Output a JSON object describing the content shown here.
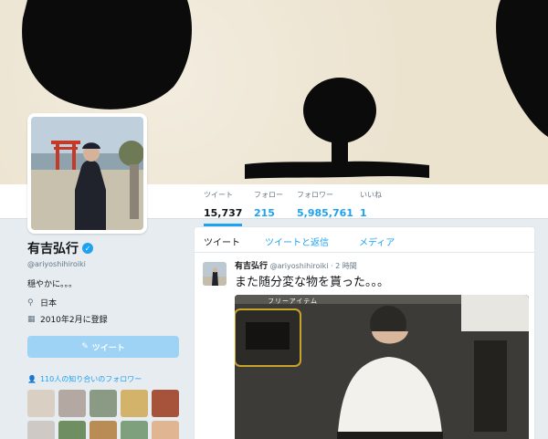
{
  "stats": [
    {
      "label": "ツイート",
      "value": "15,737"
    },
    {
      "label": "フォロー",
      "value": "215"
    },
    {
      "label": "フォロワー",
      "value": "5,985,761"
    },
    {
      "label": "いいね",
      "value": "1"
    }
  ],
  "profile": {
    "name": "有吉弘行",
    "handle": "@ariyoshihiroiki",
    "bio": "穏やかに。。。",
    "location": "日本",
    "joined": "2010年2月に登録",
    "tweet_button": "ツイート",
    "followers_you_know": "110人の知り合いのフォロワー"
  },
  "timeline": {
    "tabs": [
      "ツイート",
      "ツイートと返信",
      "メディア"
    ]
  },
  "tweet": {
    "author": "有吉弘行",
    "handle": "@ariyoshihiroiki",
    "time": "2 時間",
    "text": "また随分変な物を貰った。。。",
    "media_caption": "フリーアイテム"
  },
  "colors": {
    "accent": "#1da1f2",
    "banner": "#ece3cf",
    "background": "#e6ecf0"
  },
  "icons": [
    "verified-badge-icon",
    "location-pin-icon",
    "calendar-icon",
    "quill-icon",
    "people-icon"
  ]
}
